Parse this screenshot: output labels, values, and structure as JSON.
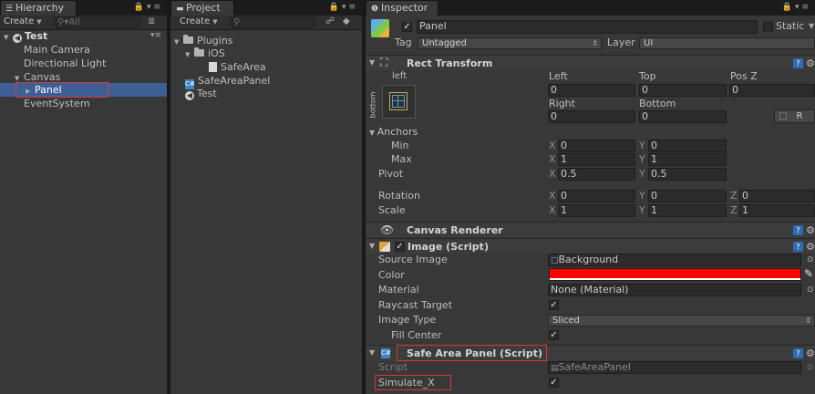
{
  "colors": {
    "panel_bg": "#383838",
    "selection": "#3e5f96",
    "color_swatch": "#ff0000",
    "annotation": "#d23b3b"
  },
  "hierarchy": {
    "tab_label": "Hierarchy",
    "create_label": "Create",
    "search_placeholder": "All",
    "scene_name": "Test",
    "items": [
      {
        "label": "Main Camera"
      },
      {
        "label": "Directional Light"
      },
      {
        "label": "Canvas"
      },
      {
        "label": "Panel"
      },
      {
        "label": "EventSystem"
      }
    ]
  },
  "project": {
    "tab_label": "Project",
    "create_label": "Create",
    "items": [
      {
        "label": "Plugins",
        "icon": "folder-icon"
      },
      {
        "label": "iOS",
        "icon": "folder-icon"
      },
      {
        "label": "SafeArea",
        "icon": "file-icon"
      },
      {
        "label": "SafeAreaPanel",
        "icon": "cs-script-icon"
      },
      {
        "label": "Test",
        "icon": "unity-scene-icon"
      }
    ]
  },
  "inspector": {
    "tab_label": "Inspector",
    "object_name": "Panel",
    "static_label": "Static",
    "tag_label": "Tag",
    "tag_value": "Untagged",
    "layer_label": "Layer",
    "layer_value": "UI",
    "rect_transform": {
      "title": "Rect Transform",
      "anchor_preset_top": "left",
      "anchor_preset_side": "bottom",
      "labels": {
        "left": "Left",
        "top": "Top",
        "posz": "Pos Z",
        "right": "Right",
        "bottom": "Bottom"
      },
      "values": {
        "left": "0",
        "top": "0",
        "posz": "0",
        "right": "0",
        "bottom": "0"
      },
      "r_button": "R",
      "anchors_label": "Anchors",
      "min_label": "Min",
      "max_label": "Max",
      "pivot_label": "Pivot",
      "min": {
        "x": "0",
        "y": "0"
      },
      "max": {
        "x": "1",
        "y": "1"
      },
      "pivot": {
        "x": "0.5",
        "y": "0.5"
      },
      "rotation_label": "Rotation",
      "scale_label": "Scale",
      "rotation": {
        "x": "0",
        "y": "0",
        "z": "0"
      },
      "scale": {
        "x": "1",
        "y": "1",
        "z": "1"
      },
      "axis": {
        "x": "X",
        "y": "Y",
        "z": "Z"
      }
    },
    "canvas_renderer": {
      "title": "Canvas Renderer"
    },
    "image": {
      "title": "Image (Script)",
      "source_image_label": "Source Image",
      "source_image_value": "Background",
      "color_label": "Color",
      "material_label": "Material",
      "material_value": "None (Material)",
      "raycast_label": "Raycast Target",
      "image_type_label": "Image Type",
      "image_type_value": "Sliced",
      "fill_center_label": "Fill Center"
    },
    "safe_area": {
      "title": "Safe Area Panel (Script)",
      "script_label": "Script",
      "script_value": "SafeAreaPanel",
      "simulate_label": "Simulate_X"
    }
  }
}
